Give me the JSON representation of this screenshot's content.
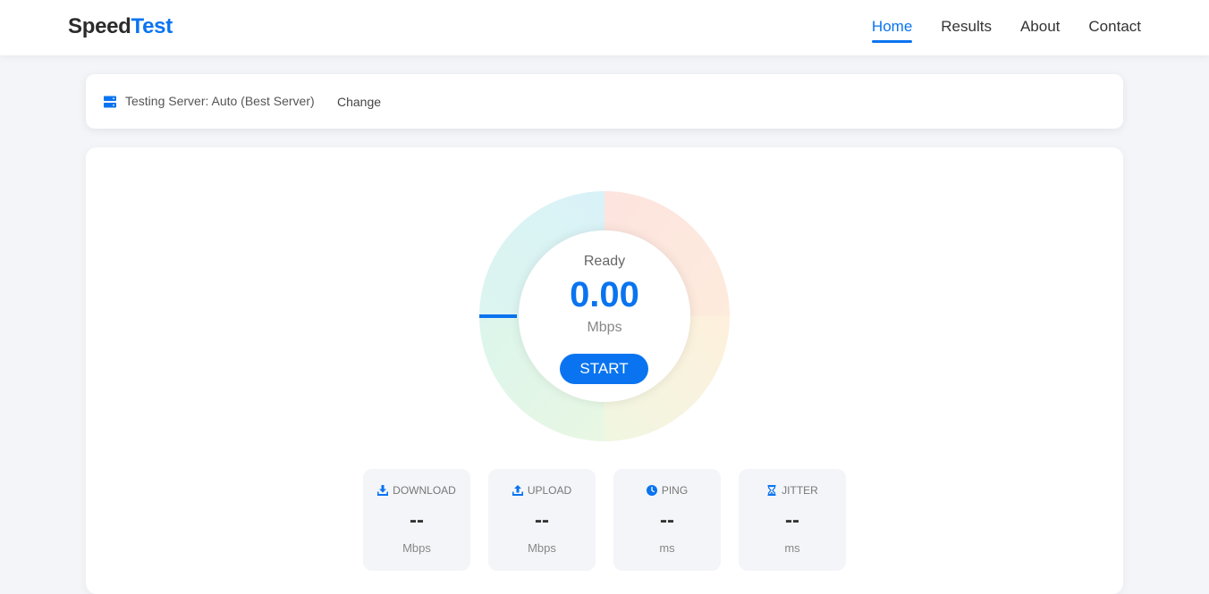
{
  "brand": {
    "part1": "Speed",
    "part2": "Test"
  },
  "nav": {
    "items": [
      {
        "label": "Home",
        "active": true
      },
      {
        "label": "Results",
        "active": false
      },
      {
        "label": "About",
        "active": false
      },
      {
        "label": "Contact",
        "active": false
      }
    ]
  },
  "server": {
    "icon": "server-icon",
    "label": "Testing Server: Auto (Best Server)",
    "change_label": "Change"
  },
  "gauge": {
    "status": "Ready",
    "speed": "0.00",
    "unit": "Mbps",
    "start_label": "START",
    "level": 0
  },
  "stats": [
    {
      "icon": "download-icon",
      "label": "DOWNLOAD",
      "value": "--",
      "unit": "Mbps"
    },
    {
      "icon": "upload-icon",
      "label": "UPLOAD",
      "value": "--",
      "unit": "Mbps"
    },
    {
      "icon": "clock-icon",
      "label": "PING",
      "value": "--",
      "unit": "ms"
    },
    {
      "icon": "hourglass-icon",
      "label": "JITTER",
      "value": "--",
      "unit": "ms"
    }
  ],
  "colors": {
    "accent": "#0a74f0",
    "background": "#f4f5f9"
  }
}
